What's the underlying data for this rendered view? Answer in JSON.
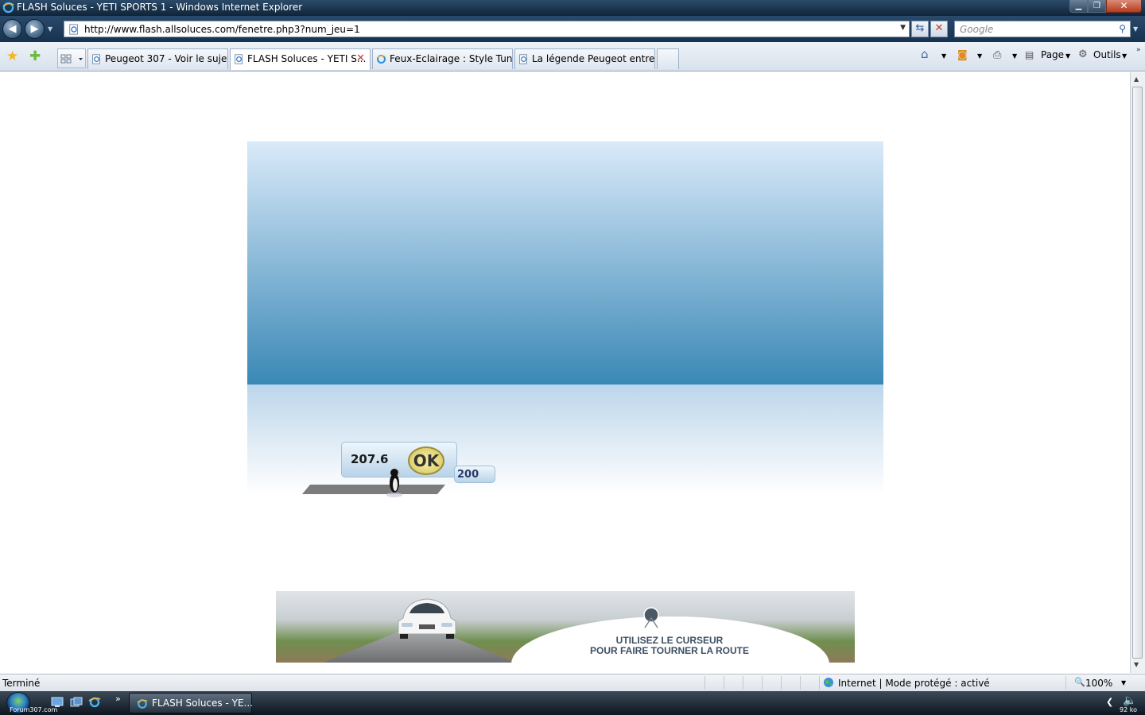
{
  "window": {
    "title": "FLASH Soluces - YETI SPORTS 1 - Windows Internet Explorer"
  },
  "nav": {
    "url": "http://www.flash.allsoluces.com/fenetre.php3?num_jeu=1",
    "search_placeholder": "Google"
  },
  "tabs": [
    {
      "label": "Peugeot 307 - Voir le sujet ..."
    },
    {
      "label": "FLASH Soluces - YETI S..."
    },
    {
      "label": "Feux-Eclairage : Style Tuni..."
    },
    {
      "label": "La légende Peugeot entre ..."
    }
  ],
  "commandbar": {
    "page_label": "Page",
    "tools_label": "Outils"
  },
  "game": {
    "distance": "207.6",
    "ok_label": "OK",
    "marker": "200"
  },
  "banner": {
    "line1": "UTILISEZ LE CURSEUR",
    "line2": "POUR FAIRE TOURNER LA ROUTE"
  },
  "status": {
    "left": "Terminé",
    "zone": "Internet | Mode protégé : activé",
    "zoom": "100%"
  },
  "taskbar": {
    "active_window": "FLASH Soluces - YE...",
    "watermark": "Forum307.com",
    "tray_size": "92 ko"
  },
  "colors": {
    "sky_top": "#daeaf9",
    "sky_bottom": "#3a88b6",
    "ie_blue": "#2a5d9f"
  }
}
